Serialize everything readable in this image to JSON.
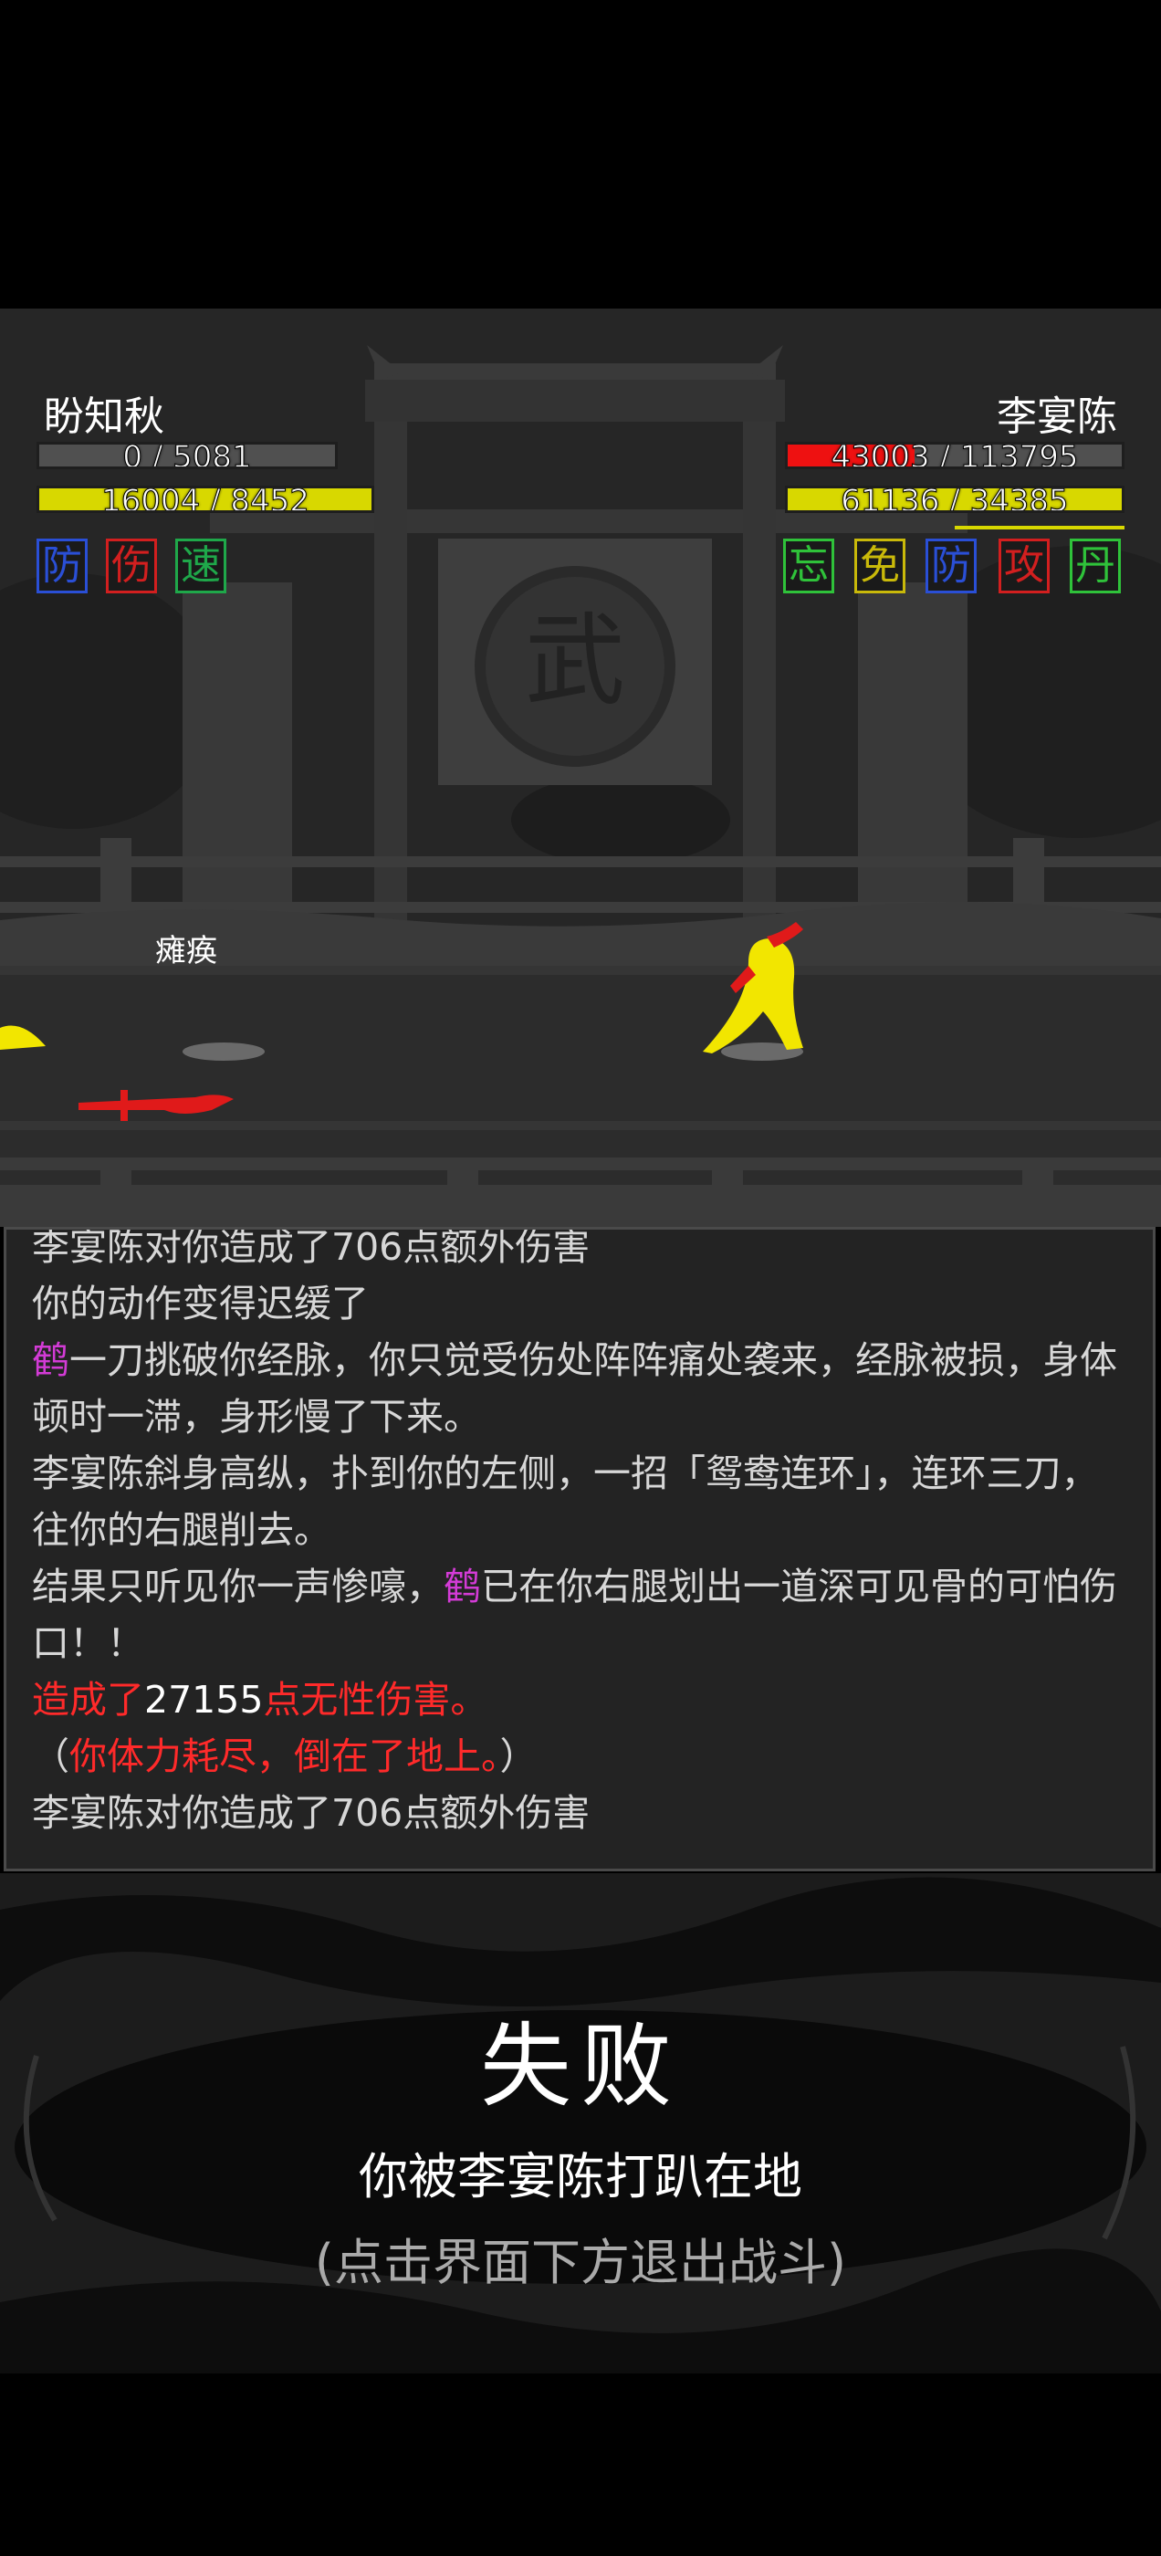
{
  "player": {
    "name": "盼知秋",
    "hp": {
      "text": "0 / 5081",
      "fraction": 0.0
    },
    "mp": {
      "text": "16004 / 8452",
      "fraction": 1.0
    },
    "buffs": [
      {
        "label": "防",
        "color": "#2a4fd6"
      },
      {
        "label": "伤",
        "color": "#d21f1f"
      },
      {
        "label": "速",
        "color": "#1fa84a"
      }
    ],
    "status": "瘫痪"
  },
  "enemy": {
    "name": "李宴陈",
    "hp": {
      "text": "43003 / 113795",
      "fraction": 0.38
    },
    "mp": {
      "text": "61136 / 34385",
      "fraction": 1.0
    },
    "buffs": [
      {
        "label": "忘",
        "color": "#2fc23a"
      },
      {
        "label": "免",
        "color": "#c9b90a"
      },
      {
        "label": "防",
        "color": "#2a4fd6"
      },
      {
        "label": "攻",
        "color": "#d21f1f"
      },
      {
        "label": "丹",
        "color": "#2fc23a"
      }
    ]
  },
  "scene": {
    "gate_sign": "武"
  },
  "log": {
    "lines": [
      {
        "segments": [
          {
            "text": "李宴陈对你造成了706点额外伤害",
            "color": "default"
          }
        ]
      },
      {
        "segments": [
          {
            "text": "你的动作变得迟缓了",
            "color": "default"
          }
        ]
      },
      {
        "segments": [
          {
            "text": "鹤",
            "color": "magenta"
          },
          {
            "text": "一刀挑破你经脉，你只觉受伤处阵阵痛处袭来，经脉被损，身体顿时一滞，身形慢了下来。",
            "color": "default"
          }
        ]
      },
      {
        "segments": [
          {
            "text": "李宴陈斜身高纵，扑到你的左侧，一招「鸳鸯连环」，连环三刀，往你的右腿削去。",
            "color": "default"
          }
        ]
      },
      {
        "segments": [
          {
            "text": "结果只听见你一声惨嚎，",
            "color": "default"
          },
          {
            "text": "鹤",
            "color": "magenta"
          },
          {
            "text": "已在你右腿划出一道深可见骨的可怕伤口！！",
            "color": "default"
          }
        ]
      },
      {
        "segments": [
          {
            "text": "造成了",
            "color": "red"
          },
          {
            "text": "27155",
            "color": "white"
          },
          {
            "text": "点无性伤害。",
            "color": "red"
          }
        ]
      },
      {
        "segments": [
          {
            "text": "（",
            "color": "default"
          },
          {
            "text": "你体力耗尽，倒在了地上。",
            "color": "red"
          },
          {
            "text": "）",
            "color": "default"
          }
        ]
      },
      {
        "segments": [
          {
            "text": "李宴陈对你造成了706点额外伤害",
            "color": "default"
          }
        ]
      }
    ]
  },
  "result": {
    "title": "失败",
    "message": "你被李宴陈打趴在地",
    "hint": "(点击界面下方退出战斗)"
  }
}
